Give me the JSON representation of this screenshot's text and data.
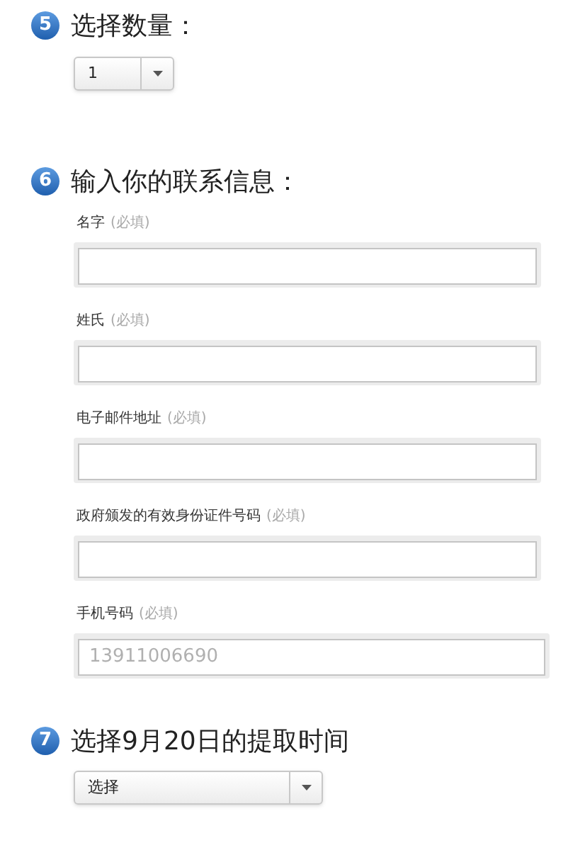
{
  "steps": [
    {
      "number": "5",
      "title": "选择数量：",
      "kind": "quantity",
      "select": {
        "value": "1"
      }
    },
    {
      "number": "6",
      "title": "输入你的联系信息：",
      "kind": "contact",
      "fields": [
        {
          "label": "名字",
          "required": "(必填)"
        },
        {
          "label": "姓氏",
          "required": "(必填)"
        },
        {
          "label": "电子邮件地址",
          "required": "(必填)"
        },
        {
          "label": "政府颁发的有效身份证件号码",
          "required": "(必填)"
        },
        {
          "label": "手机号码",
          "required": "(必填)",
          "placeholder": "13911006690"
        }
      ]
    },
    {
      "number": "7",
      "title": "选择9月20日的提取时间",
      "kind": "time",
      "select": {
        "value": "选择"
      }
    }
  ]
}
